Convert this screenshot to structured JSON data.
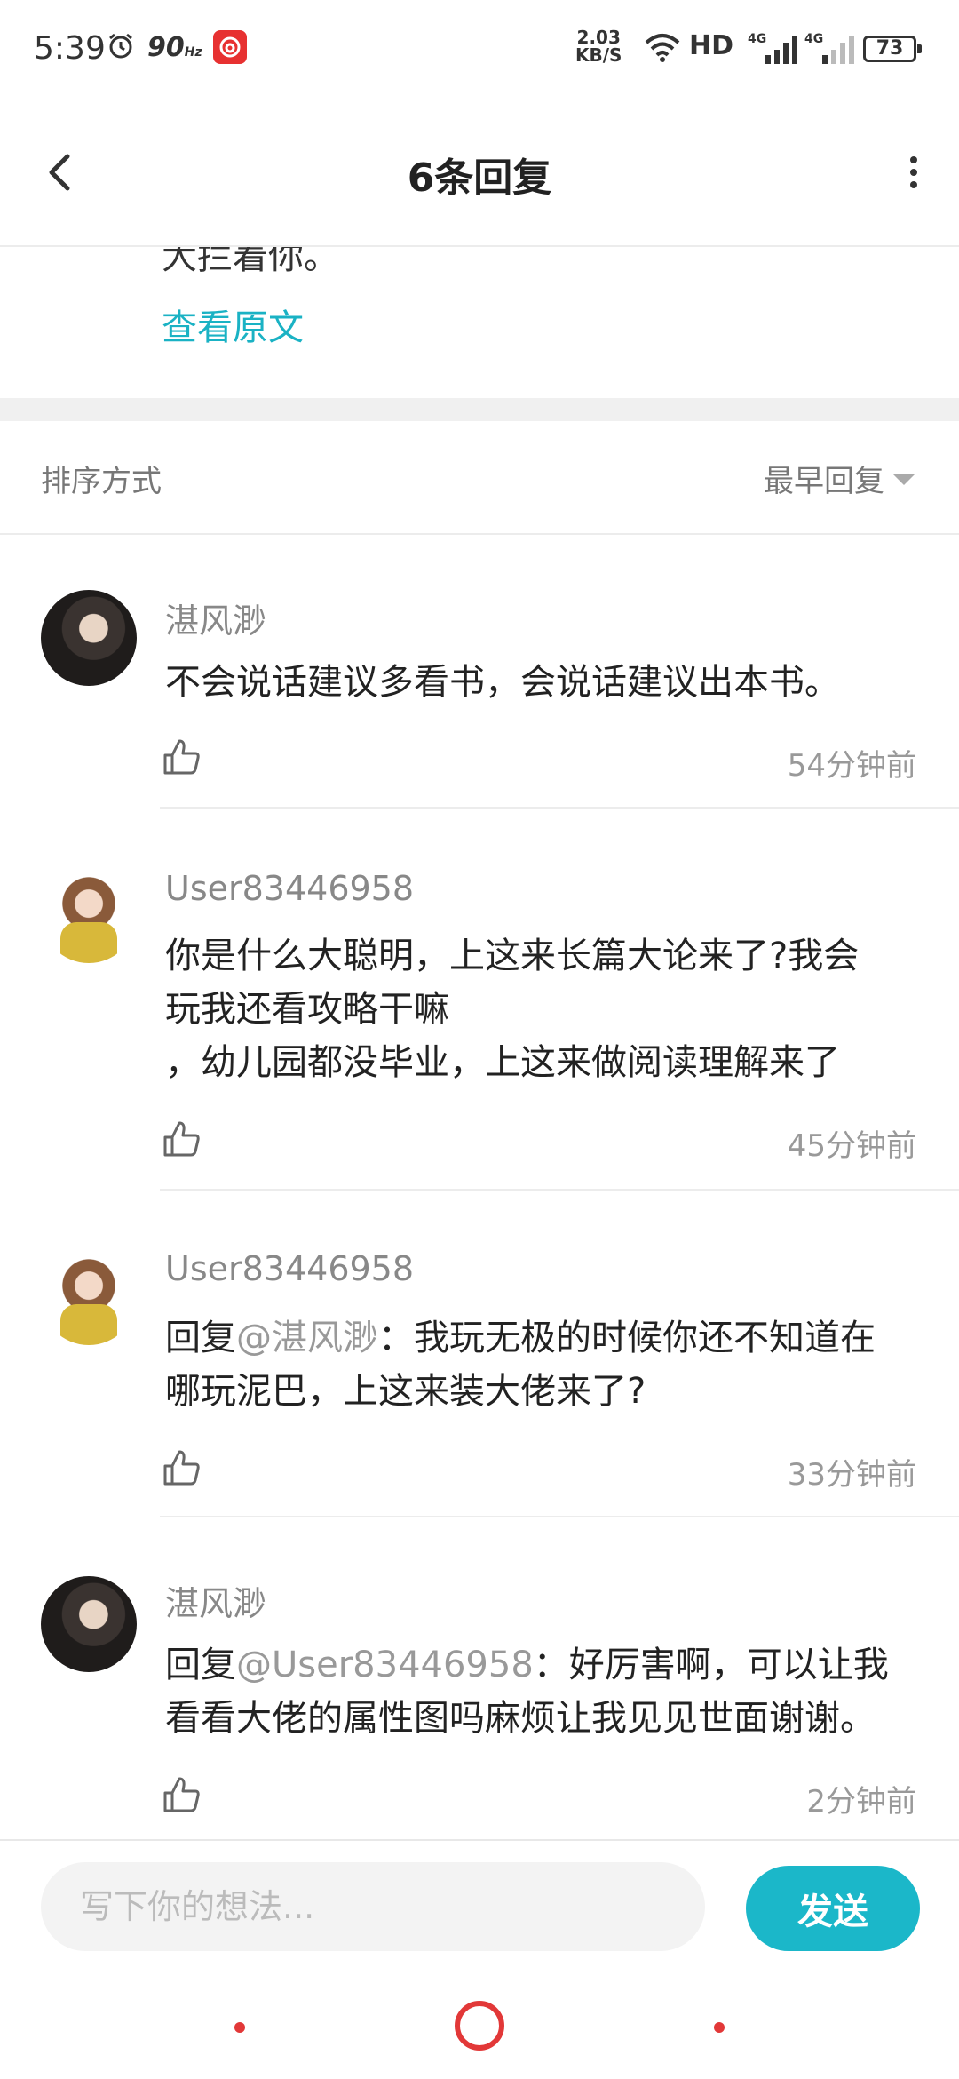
{
  "status_bar": {
    "time": "5:39",
    "refresh_rate": "90",
    "refresh_unit": "Hz",
    "net_speed_value": "2.03",
    "net_speed_unit": "KB/S",
    "hd_label": "HD",
    "signal1_label": "4G",
    "signal2_label": "4G",
    "battery": "73"
  },
  "header": {
    "title": "6条回复"
  },
  "original_post": {
    "cut_text": "大拦着你。",
    "view_original": "查看原文"
  },
  "sort": {
    "label": "排序方式",
    "value": "最早回复"
  },
  "replies": [
    {
      "username": "湛风渺",
      "content": "不会说话建议多看书，会说话建议出本书。",
      "time": "54分钟前"
    },
    {
      "username": "User83446958",
      "line1": "你是什么大聪明，上这来长篇大论来了?我会",
      "line2": "玩我还看攻略干嘛",
      "line3": "，幼儿园都没毕业，上这来做阅读理解来了",
      "time": "45分钟前"
    },
    {
      "username": "User83446958",
      "prefix": "回复",
      "mention": "@湛风渺",
      "line1_rest": "：我玩无极的时候你还不知道在",
      "line2": "哪玩泥巴，上这来装大佬来了?",
      "time": "33分钟前"
    },
    {
      "username": "湛风渺",
      "prefix": "回复",
      "mention": "@User83446958",
      "line1_rest": "：好厉害啊，可以让我",
      "line2": "看看大佬的属性图吗麻烦让我见见世面谢谢。",
      "time": "2分钟前"
    }
  ],
  "input": {
    "placeholder": "写下你的想法...",
    "send_label": "发送"
  },
  "colors": {
    "accent": "#1bb7c9",
    "link": "#1ab2c4",
    "nav": "#e23838"
  }
}
